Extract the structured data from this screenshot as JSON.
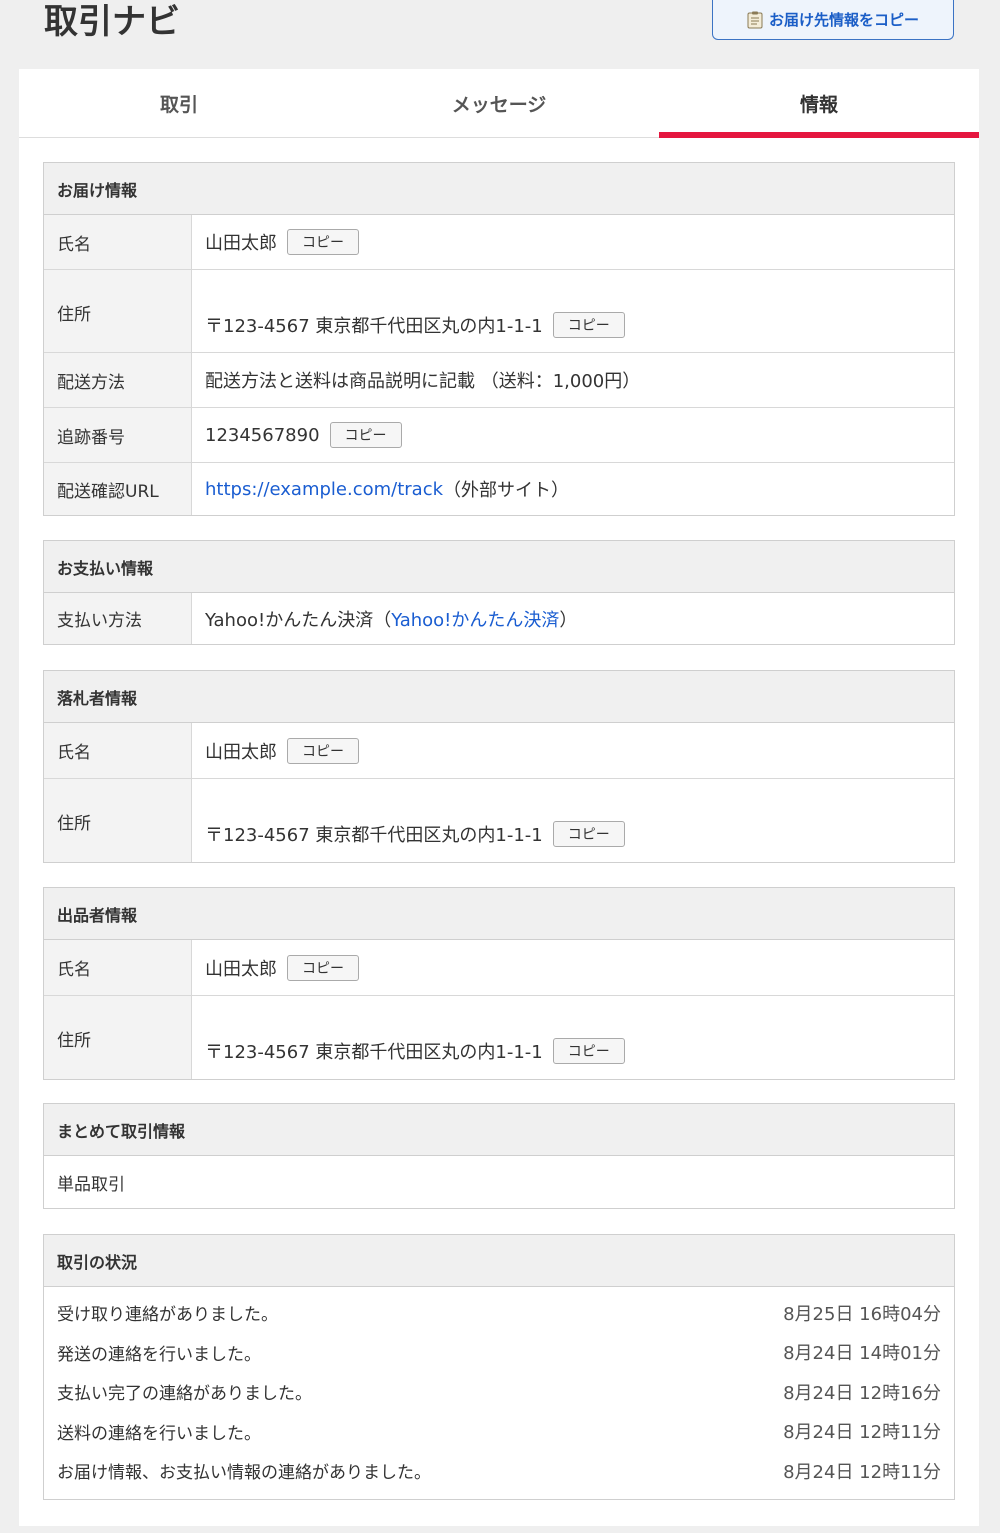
{
  "header": {
    "title": "取引ナビ",
    "copy_dest_label": "お届け先情報をコピー"
  },
  "tabs": [
    {
      "label": "取引"
    },
    {
      "label": "メッセージ"
    },
    {
      "label": "情報"
    }
  ],
  "copy_label": "コピー",
  "delivery": {
    "heading": "お届け情報",
    "name_label": "氏名",
    "name_value": "山田太郎",
    "address_label": "住所",
    "address_value": "〒123-4567 東京都千代田区丸の内1-1-1",
    "method_label": "配送方法",
    "method_value": "配送方法と送料は商品説明に記載 （送料：1,000円）",
    "tracking_label": "追跡番号",
    "tracking_value": "1234567890",
    "url_label": "配送確認URL",
    "url_link": "https://example.com/track",
    "url_suffix": "（外部サイト）"
  },
  "payment": {
    "heading": "お支払い情報",
    "method_label": "支払い方法",
    "method_value": "Yahoo!かんたん決済（",
    "method_link": "Yahoo!かんたん決済",
    "method_suffix": "）"
  },
  "buyer": {
    "heading": "落札者情報",
    "name_label": "氏名",
    "name_value": "山田太郎",
    "address_label": "住所",
    "address_value": "〒123-4567 東京都千代田区丸の内1-1-1"
  },
  "seller": {
    "heading": "出品者情報",
    "name_label": "氏名",
    "name_value": "山田太郎",
    "address_label": "住所",
    "address_value": "〒123-4567 東京都千代田区丸の内1-1-1"
  },
  "bundle": {
    "heading": "まとめて取引情報",
    "value": "単品取引"
  },
  "status": {
    "heading": "取引の状況",
    "items": [
      {
        "text": "受け取り連絡がありました。",
        "time": "8月25日 16時04分"
      },
      {
        "text": "発送の連絡を行いました。",
        "time": "8月24日 14時01分"
      },
      {
        "text": "支払い完了の連絡がありました。",
        "time": "8月24日 12時16分"
      },
      {
        "text": "送料の連絡を行いました。",
        "time": "8月24日 12時11分"
      },
      {
        "text": "お届け情報、お支払い情報の連絡がありました。",
        "time": "8月24日 12時11分"
      }
    ]
  }
}
